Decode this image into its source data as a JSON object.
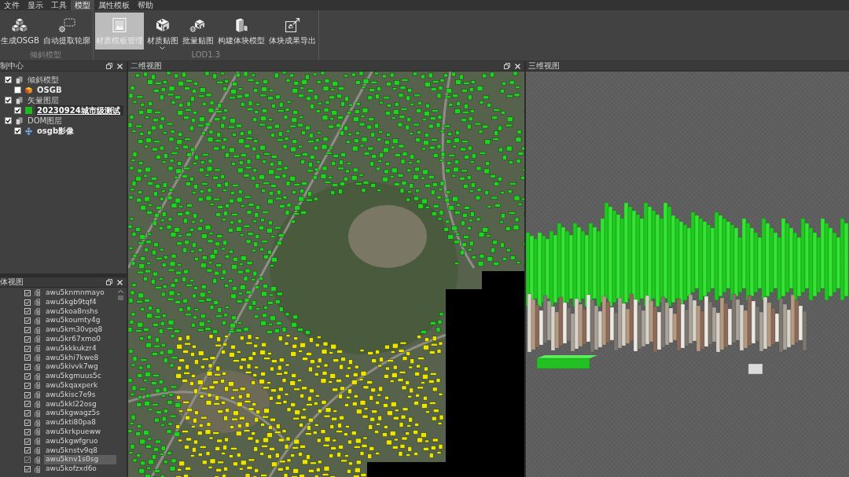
{
  "menu_bar": {
    "items": [
      {
        "label": "文件",
        "selected": false
      },
      {
        "label": "显示",
        "selected": false
      },
      {
        "label": "工具",
        "selected": false
      },
      {
        "label": "模型",
        "selected": true
      },
      {
        "label": "属性模板",
        "selected": false
      },
      {
        "label": "帮助",
        "selected": false
      }
    ]
  },
  "ribbon": {
    "groups": [
      {
        "label": "倾斜模型",
        "buttons": [
          {
            "label": "生成OSGB",
            "kind": "plain",
            "selected": false
          },
          {
            "label": "自动提取轮廓",
            "kind": "plain",
            "selected": false
          }
        ]
      },
      {
        "label": "LOD1.3",
        "buttons": [
          {
            "label": "材质模板管理",
            "kind": "plain",
            "selected": true
          },
          {
            "label": "材质贴图",
            "kind": "dropdown",
            "selected": false
          },
          {
            "label": "批量贴图",
            "kind": "plain",
            "selected": false
          },
          {
            "label": "构建体块模型",
            "kind": "plain",
            "selected": false
          },
          {
            "label": "体块成果导出",
            "kind": "plain",
            "selected": false
          }
        ]
      }
    ]
  },
  "layer_panel": {
    "title": "制中心",
    "items": [
      {
        "label": "倾斜模型",
        "kind": "group",
        "checked": true,
        "selected": false,
        "children": [
          {
            "label": "OSGB",
            "kind": "model",
            "checked": false,
            "selected": false
          }
        ]
      },
      {
        "label": "矢量图层",
        "kind": "group",
        "checked": true,
        "selected": false,
        "children": [
          {
            "label": "20230924城市级测试",
            "kind": "vector",
            "color": "#1fb81f",
            "checked": true,
            "selected": true
          }
        ]
      },
      {
        "label": "DOM图层",
        "kind": "group",
        "checked": true,
        "selected": false,
        "children": [
          {
            "label": "osgb影像",
            "kind": "imagery",
            "checked": true,
            "selected": false
          }
        ]
      }
    ]
  },
  "entity_panel": {
    "title": "体视图",
    "items": [
      {
        "label": "awu5knmnmayo",
        "checked": true,
        "selected": false
      },
      {
        "label": "awu5kgb9tqf4",
        "checked": true,
        "selected": false
      },
      {
        "label": "awu5koa8nshs",
        "checked": true,
        "selected": false
      },
      {
        "label": "awu5koumty4g",
        "checked": true,
        "selected": false
      },
      {
        "label": "awu5km30vpq8",
        "checked": true,
        "selected": false
      },
      {
        "label": "awu5kr67xmo0",
        "checked": true,
        "selected": false
      },
      {
        "label": "awu5kkkukzr4",
        "checked": true,
        "selected": false
      },
      {
        "label": "awu5khi7kwe8",
        "checked": true,
        "selected": false
      },
      {
        "label": "awu5kivvk7wg",
        "checked": true,
        "selected": false
      },
      {
        "label": "awu5kgmuus5c",
        "checked": true,
        "selected": false
      },
      {
        "label": "awu5kqaxperk",
        "checked": true,
        "selected": false
      },
      {
        "label": "awu5kisc7e9s",
        "checked": true,
        "selected": false
      },
      {
        "label": "awu5kkl22osg",
        "checked": true,
        "selected": false
      },
      {
        "label": "awu5kgwagz5s",
        "checked": true,
        "selected": false
      },
      {
        "label": "awu5kti80pa8",
        "checked": true,
        "selected": false
      },
      {
        "label": "awu5krkpueww",
        "checked": true,
        "selected": false
      },
      {
        "label": "awu5kgwfgruo",
        "checked": true,
        "selected": false
      },
      {
        "label": "awu5knstv9q8",
        "checked": true,
        "selected": false
      },
      {
        "label": "awu5knv1s0sg",
        "checked": true,
        "selected": true
      },
      {
        "label": "awu5kofzxd6o",
        "checked": true,
        "selected": false
      }
    ]
  },
  "view_2d": {
    "title": "二维视图"
  },
  "view_3d": {
    "title": "三维视图"
  }
}
